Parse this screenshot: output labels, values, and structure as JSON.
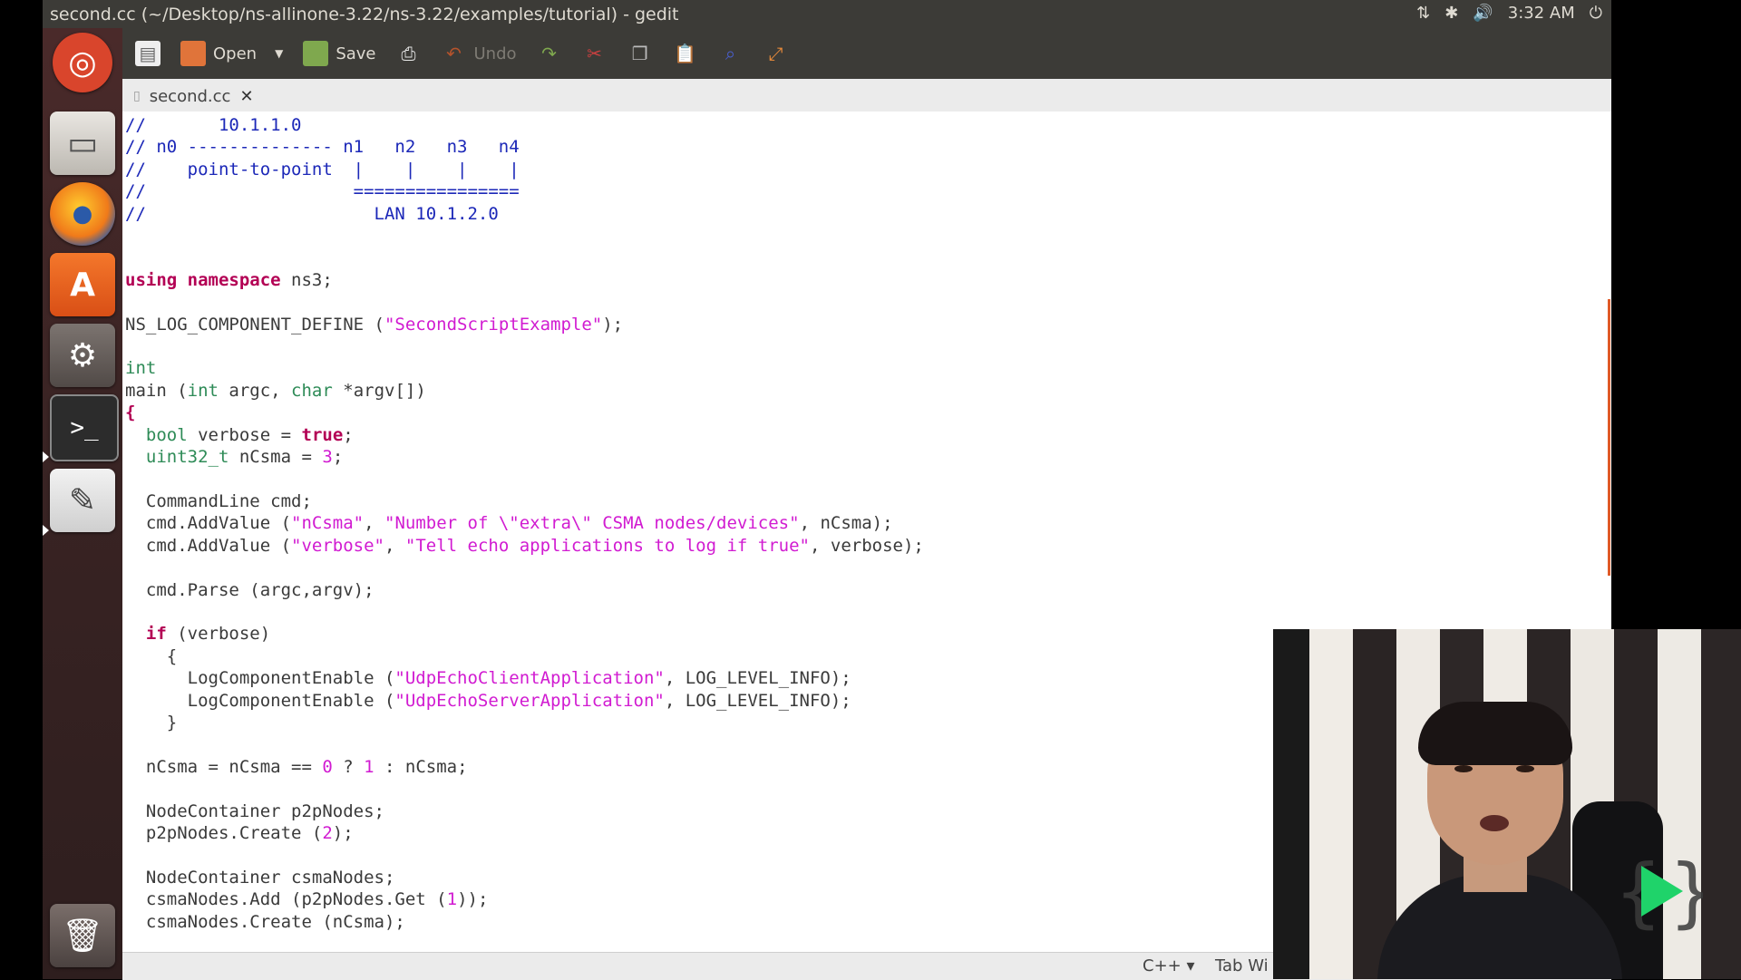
{
  "window": {
    "title": "second.cc (~/Desktop/ns-allinone-3.22/ns-3.22/examples/tutorial) - gedit"
  },
  "tray": {
    "network": "⇅",
    "bluetooth": "✱",
    "volume": "🔊",
    "time": "3:32 AM",
    "power": "⏻"
  },
  "launcher": [
    {
      "name": "dash-home",
      "glyph": "◎"
    },
    {
      "name": "files",
      "glyph": "▭"
    },
    {
      "name": "firefox",
      "glyph": "●"
    },
    {
      "name": "software-center",
      "glyph": "A"
    },
    {
      "name": "system-settings",
      "glyph": "⚙"
    },
    {
      "name": "terminal",
      "glyph": ">_"
    },
    {
      "name": "text-editor",
      "glyph": "✎"
    },
    {
      "name": "trash",
      "glyph": "🗑"
    }
  ],
  "toolbar": {
    "open_label": "Open",
    "save_label": "Save",
    "undo_label": "Undo"
  },
  "tab": {
    "label": "second.cc",
    "close": "✕"
  },
  "code_lines": [
    [
      [
        "cm",
        "//       10.1.1.0"
      ]
    ],
    [
      [
        "cm",
        "// n0 -------------- n1   n2   n3   n4"
      ]
    ],
    [
      [
        "cm",
        "//    point-to-point  |    |    |    |"
      ]
    ],
    [
      [
        "cm",
        "//                    ================"
      ]
    ],
    [
      [
        "cm",
        "//                      LAN 10.1.2.0"
      ]
    ],
    [
      [
        "tx",
        ""
      ]
    ],
    [
      [
        "tx",
        ""
      ]
    ],
    [
      [
        "kw",
        "using"
      ],
      [
        "tx",
        " "
      ],
      [
        "kw",
        "namespace"
      ],
      [
        "tx",
        " ns3;"
      ]
    ],
    [
      [
        "tx",
        ""
      ]
    ],
    [
      [
        "tx",
        "NS_LOG_COMPONENT_DEFINE ("
      ],
      [
        "st",
        "\"SecondScriptExample\""
      ],
      [
        "tx",
        ");"
      ]
    ],
    [
      [
        "tx",
        ""
      ]
    ],
    [
      [
        "ty",
        "int"
      ]
    ],
    [
      [
        "tx",
        "main ("
      ],
      [
        "ty",
        "int"
      ],
      [
        "tx",
        " argc, "
      ],
      [
        "ty",
        "char"
      ],
      [
        "tx",
        " *argv[])"
      ]
    ],
    [
      [
        "kw",
        "{"
      ]
    ],
    [
      [
        "tx",
        "  "
      ],
      [
        "ty",
        "bool"
      ],
      [
        "tx",
        " verbose = "
      ],
      [
        "kw",
        "true"
      ],
      [
        "tx",
        ";"
      ]
    ],
    [
      [
        "tx",
        "  "
      ],
      [
        "ty",
        "uint32_t"
      ],
      [
        "tx",
        " nCsma = "
      ],
      [
        "nm",
        "3"
      ],
      [
        "tx",
        ";"
      ]
    ],
    [
      [
        "tx",
        ""
      ]
    ],
    [
      [
        "tx",
        "  CommandLine cmd;"
      ]
    ],
    [
      [
        "tx",
        "  cmd.AddValue ("
      ],
      [
        "st",
        "\"nCsma\""
      ],
      [
        "tx",
        ", "
      ],
      [
        "st",
        "\"Number of \\\"extra\\\" CSMA nodes/devices\""
      ],
      [
        "tx",
        ", nCsma);"
      ]
    ],
    [
      [
        "tx",
        "  cmd.AddValue ("
      ],
      [
        "st",
        "\"verbose\""
      ],
      [
        "tx",
        ", "
      ],
      [
        "st",
        "\"Tell echo applications to log if true\""
      ],
      [
        "tx",
        ", verbose);"
      ]
    ],
    [
      [
        "tx",
        ""
      ]
    ],
    [
      [
        "tx",
        "  cmd.Parse (argc,argv);"
      ]
    ],
    [
      [
        "tx",
        ""
      ]
    ],
    [
      [
        "tx",
        "  "
      ],
      [
        "kw",
        "if"
      ],
      [
        "tx",
        " (verbose)"
      ]
    ],
    [
      [
        "tx",
        "    {"
      ]
    ],
    [
      [
        "tx",
        "      LogComponentEnable ("
      ],
      [
        "st",
        "\"UdpEchoClientApplication\""
      ],
      [
        "tx",
        ", LOG_LEVEL_INFO);"
      ]
    ],
    [
      [
        "tx",
        "      LogComponentEnable ("
      ],
      [
        "st",
        "\"UdpEchoServerApplication\""
      ],
      [
        "tx",
        ", LOG_LEVEL_INFO);"
      ]
    ],
    [
      [
        "tx",
        "    }"
      ]
    ],
    [
      [
        "tx",
        ""
      ]
    ],
    [
      [
        "tx",
        "  nCsma = nCsma == "
      ],
      [
        "nm",
        "0"
      ],
      [
        "tx",
        " ? "
      ],
      [
        "nm",
        "1"
      ],
      [
        "tx",
        " : nCsma;"
      ]
    ],
    [
      [
        "tx",
        ""
      ]
    ],
    [
      [
        "tx",
        "  NodeContainer p2pNodes;"
      ]
    ],
    [
      [
        "tx",
        "  p2pNodes.Create ("
      ],
      [
        "nm",
        "2"
      ],
      [
        "tx",
        ");"
      ]
    ],
    [
      [
        "tx",
        ""
      ]
    ],
    [
      [
        "tx",
        "  NodeContainer csmaNodes;"
      ]
    ],
    [
      [
        "tx",
        "  csmaNodes.Add (p2pNodes.Get ("
      ],
      [
        "nm",
        "1"
      ],
      [
        "tx",
        "));"
      ]
    ],
    [
      [
        "tx",
        "  csmaNodes.Create (nCsma);"
      ]
    ]
  ],
  "statusbar": {
    "language": "C++ ▾",
    "tab_width": "Tab Wi"
  }
}
